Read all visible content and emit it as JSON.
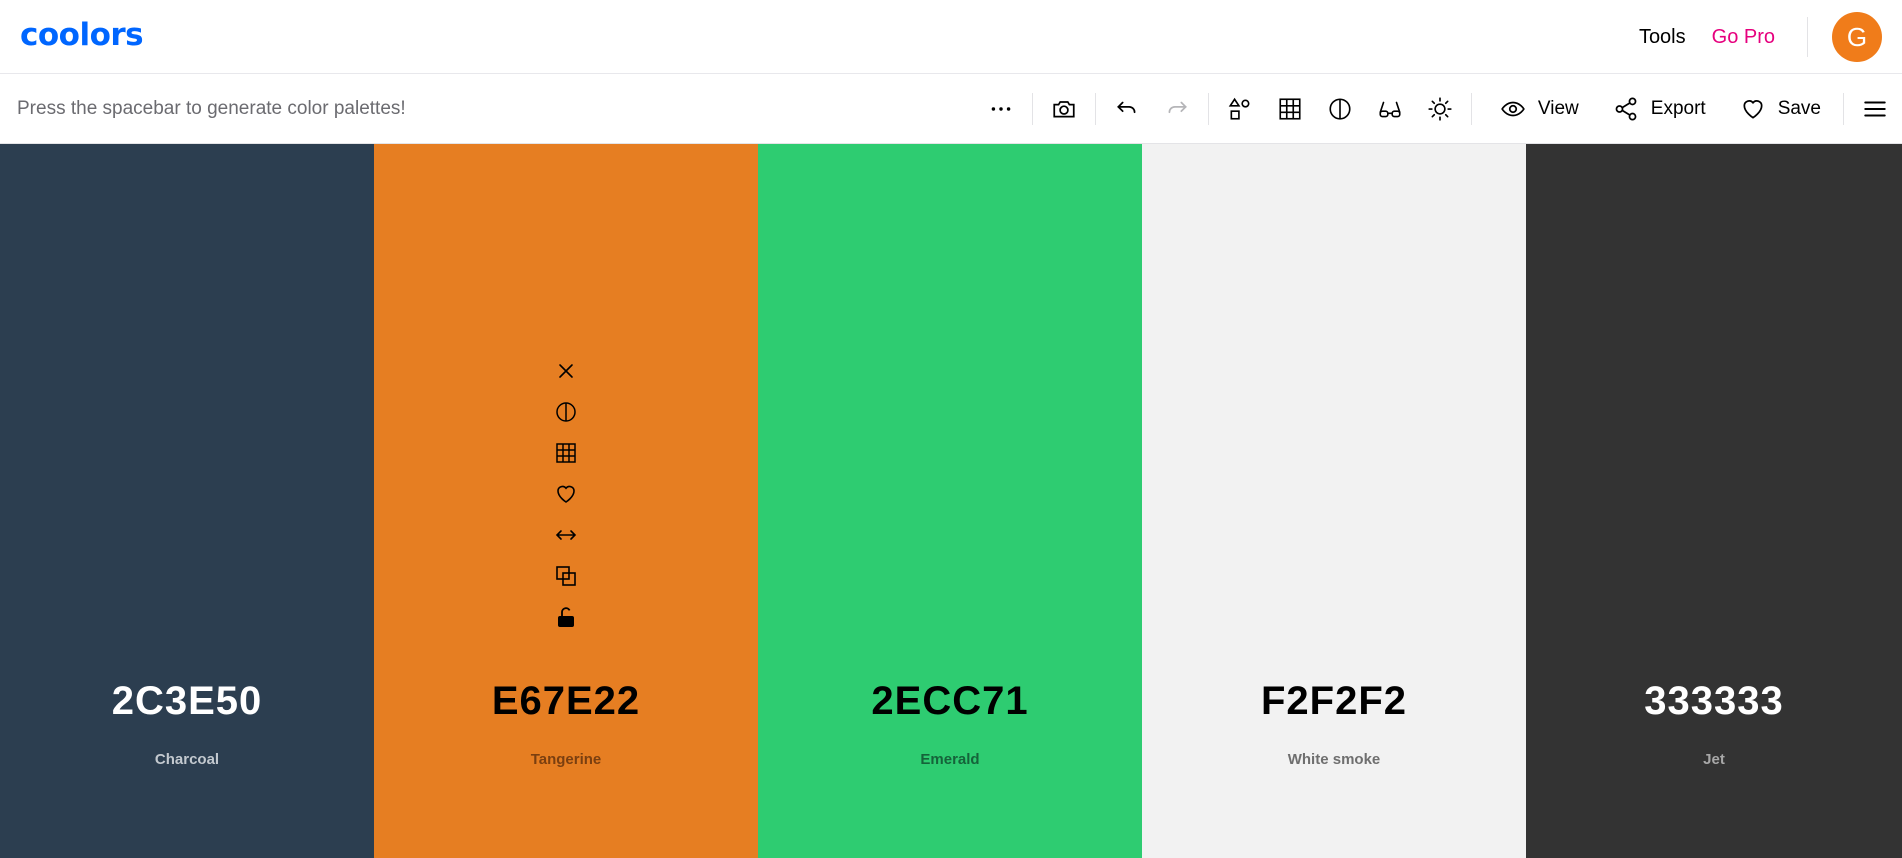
{
  "header": {
    "logo": "coolors",
    "tools_label": "Tools",
    "pro_label": "Go Pro",
    "avatar_initial": "G"
  },
  "toolbar": {
    "hint": "Press the spacebar to generate color palettes!",
    "view_label": "View",
    "export_label": "Export",
    "save_label": "Save"
  },
  "colors": {
    "accent": "#0066ff",
    "pro": "#e6007e",
    "avatar": "#f07c1a"
  },
  "palette": [
    {
      "hex": "2C3E50",
      "name": "Charcoal",
      "color": "#2c3e50"
    },
    {
      "hex": "E67E22",
      "name": "Tangerine",
      "color": "#e67e22"
    },
    {
      "hex": "2ECC71",
      "name": "Emerald",
      "color": "#2ecc71"
    },
    {
      "hex": "F2F2F2",
      "name": "White smoke",
      "color": "#f2f2f2"
    },
    {
      "hex": "333333",
      "name": "Jet",
      "color": "#333333"
    }
  ],
  "swatch_tool_icons": [
    "close-icon",
    "contrast-icon",
    "shades-grid-icon",
    "heart-icon",
    "drag-arrows-icon",
    "copy-icon",
    "unlock-icon"
  ]
}
